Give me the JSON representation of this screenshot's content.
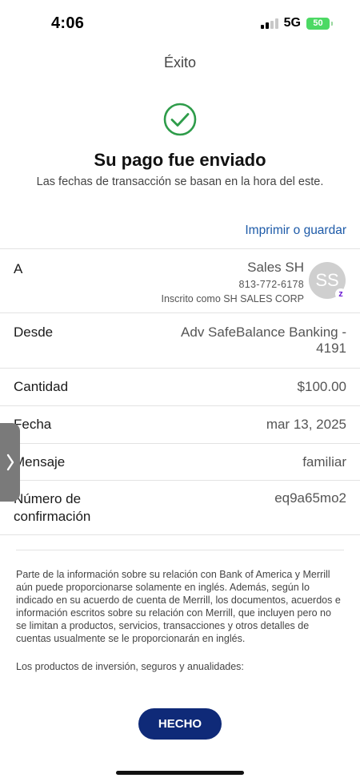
{
  "status_bar": {
    "time": "4:06",
    "network": "5G",
    "battery": "50"
  },
  "header": {
    "title": "Éxito"
  },
  "confirmation": {
    "title": "Su pago fue enviado",
    "subtitle": "Las fechas de transacción se basan en la hora del este.",
    "print_link": "Imprimir o guardar"
  },
  "details": {
    "to": {
      "label": "A",
      "name": "Sales SH",
      "phone": "813-772-6178",
      "enrolled": "Inscrito como SH SALES CORP",
      "avatar_initials": "SS",
      "badge_icon": "zelle-icon"
    },
    "from": {
      "label": "Desde",
      "value_line1": "Adv SafeBalance Banking -",
      "value_line2": "4191"
    },
    "amount": {
      "label": "Cantidad",
      "value": "$100.00"
    },
    "date": {
      "label": "Fecha",
      "value": "mar 13, 2025"
    },
    "message": {
      "label": "Mensaje",
      "value": "familiar"
    },
    "confirmation_number": {
      "label_line1": "Número de",
      "label_line2": "confirmación",
      "value": "eq9a65mo2"
    }
  },
  "disclaimer": {
    "paragraph1": "Parte de la información sobre su relación con Bank of America y Merrill aún puede proporcionarse solamente en inglés. Además, según lo indicado en su acuerdo de cuenta de Merrill, los documentos, acuerdos e información escritos sobre su relación con Merrill, que incluyen pero no se limitan a productos, servicios, transacciones y otros detalles de cuentas usualmente se le proporcionarán en inglés.",
    "paragraph2": "Los productos de inversión, seguros y anualidades:"
  },
  "footer": {
    "done_label": "HECHO"
  },
  "colors": {
    "accent_link": "#1d5aa8",
    "button": "#0f2a78",
    "success": "#2e9c4a",
    "zelle": "#6d1ed4"
  }
}
